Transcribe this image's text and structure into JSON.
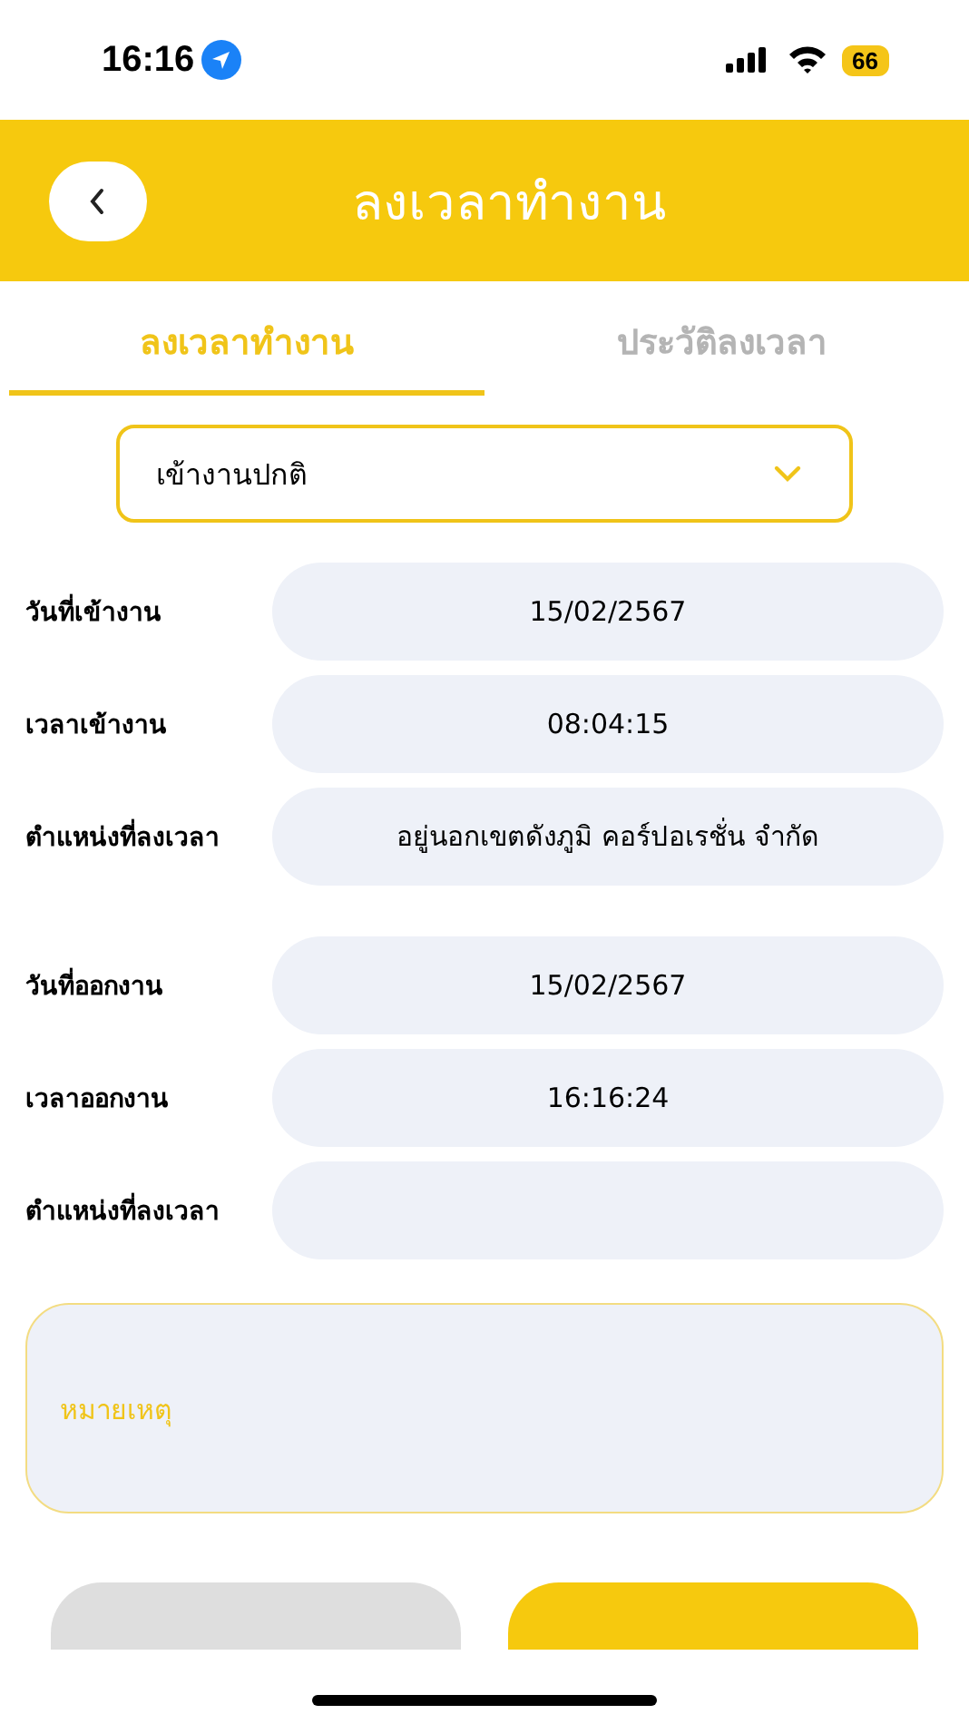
{
  "status_bar": {
    "time": "16:16",
    "battery": "66"
  },
  "header": {
    "title": "ลงเวลาทำงาน"
  },
  "tabs": [
    {
      "label": "ลงเวลาทำงาน",
      "selected": true
    },
    {
      "label": "ประวัติลงเวลา",
      "selected": false
    }
  ],
  "dropdown": {
    "value": "เข้างานปกติ"
  },
  "check_in": [
    {
      "label": "วันที่เข้างาน",
      "value": "15/02/2567"
    },
    {
      "label": "เวลาเข้างาน",
      "value": "08:04:15"
    },
    {
      "label": "ตำแหน่งที่ลงเวลา",
      "value": "อยู่นอกเขตดังภูมิ คอร์ปอเรชั่น จำกัด"
    }
  ],
  "check_out": [
    {
      "label": "วันที่ออกงาน",
      "value": "15/02/2567"
    },
    {
      "label": "เวลาออกงาน",
      "value": "16:16:24"
    },
    {
      "label": "ตำแหน่งที่ลงเวลา"
    }
  ],
  "remark": {
    "placeholder": "หมายเหตุ"
  },
  "buttons": [
    {
      "disabled": true
    },
    {
      "disabled": false
    }
  ]
}
